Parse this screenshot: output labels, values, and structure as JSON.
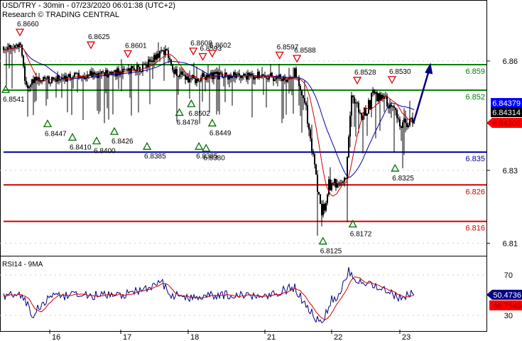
{
  "header": {
    "title": "USD/TRY - 30min - 07/23/2020 06:01:38 (UTC+2)",
    "subtitle": "Research © TRADING CENTRAL"
  },
  "chart_data": {
    "type": "candlestick",
    "symbol": "USD/TRY",
    "interval": "30min",
    "x_ticks": [
      "16",
      "17",
      "18",
      "21",
      "22",
      "23"
    ],
    "x_tick_days": [
      16,
      17,
      18,
      21,
      22,
      23
    ],
    "y_ticks": [
      6.86,
      6.83,
      6.81
    ],
    "price_path": [
      [
        15.33,
        6.864
      ],
      [
        15.6,
        6.864
      ],
      [
        15.66,
        6.853
      ],
      [
        15.75,
        6.8545
      ],
      [
        16.0,
        6.855
      ],
      [
        16.5,
        6.856
      ],
      [
        17.0,
        6.857
      ],
      [
        17.3,
        6.858
      ],
      [
        17.66,
        6.863
      ],
      [
        17.8,
        6.857
      ],
      [
        18.0,
        6.855
      ],
      [
        18.3,
        6.855
      ],
      [
        18.7,
        6.856
      ],
      [
        21.0,
        6.856
      ],
      [
        21.3,
        6.855
      ],
      [
        21.45,
        6.857
      ],
      [
        21.6,
        6.848
      ],
      [
        21.75,
        6.83
      ],
      [
        21.85,
        6.817
      ],
      [
        21.95,
        6.826
      ],
      [
        22.2,
        6.826
      ],
      [
        22.3,
        6.851
      ],
      [
        22.45,
        6.844
      ],
      [
        22.6,
        6.85
      ],
      [
        22.9,
        6.848
      ],
      [
        23.0,
        6.842
      ],
      [
        23.2,
        6.843
      ]
    ],
    "levels": [
      {
        "value": "6.859",
        "color": "#008000"
      },
      {
        "value": "6.852",
        "color": "#008000"
      },
      {
        "value": "6.835",
        "color": "#0000a0"
      },
      {
        "value": "6.826",
        "color": "#d00000"
      },
      {
        "value": "6.816",
        "color": "#d00000"
      }
    ],
    "highs": [
      {
        "day": 15.58,
        "value": "6.8660"
      },
      {
        "day": 16.58,
        "value": "6.8625"
      },
      {
        "day": 17.105,
        "value": "6.8601"
      },
      {
        "day": 18.2,
        "value": "6.8608"
      },
      {
        "day": 18.57,
        "value": "6.8593"
      },
      {
        "day": 18.94,
        "value": "6.8602"
      },
      {
        "day": 21.22,
        "value": "6.8597"
      },
      {
        "day": 21.48,
        "value": "6.8588"
      },
      {
        "day": 22.375,
        "value": "6.8528"
      },
      {
        "day": 22.885,
        "value": "6.8530"
      }
    ],
    "lows": [
      {
        "day": 15.38,
        "value": "6.8541"
      },
      {
        "day": 15.97,
        "value": "6.8447"
      },
      {
        "day": 16.32,
        "value": "6.8410"
      },
      {
        "day": 16.66,
        "value": "6.8400"
      },
      {
        "day": 16.91,
        "value": "6.8426"
      },
      {
        "day": 17.39,
        "value": "6.8385"
      },
      {
        "day": 17.87,
        "value": "6.8478"
      },
      {
        "day": 18.12,
        "value": "6.8502"
      },
      {
        "day": 18.42,
        "value": "6.8385"
      },
      {
        "day": 18.7,
        "value": "6.8380"
      },
      {
        "day": 18.94,
        "value": "6.8449"
      },
      {
        "day": 21.87,
        "value": "6.8125"
      },
      {
        "day": 22.31,
        "value": "6.8172"
      },
      {
        "day": 22.93,
        "value": "6.8325"
      }
    ],
    "projection": {
      "from": [
        23.2,
        6.843
      ],
      "to": [
        23.45,
        6.8595
      ],
      "color": "#000080"
    },
    "price_tags": [
      {
        "value": "6.84379",
        "bg": "#0000ff",
        "fg": "#ffffff"
      },
      {
        "value": "6.84314",
        "bg": "#000000",
        "fg": "#ffffff"
      },
      {
        "value": "6.84306",
        "bg": "#ff0000",
        "fg": "#cc0000"
      }
    ],
    "moving_averages": [
      {
        "color": "#d00000"
      },
      {
        "color": "#0000a0"
      }
    ],
    "rsi": {
      "title": "RSI14 - 9MA",
      "y_ticks": [
        70,
        30
      ],
      "path": [
        [
          15.33,
          48
        ],
        [
          15.55,
          53
        ],
        [
          15.7,
          40
        ],
        [
          15.75,
          28
        ],
        [
          15.85,
          38
        ],
        [
          16.0,
          48
        ],
        [
          16.5,
          50
        ],
        [
          17.0,
          50
        ],
        [
          17.5,
          58
        ],
        [
          17.6,
          66
        ],
        [
          17.7,
          52
        ],
        [
          18.0,
          47
        ],
        [
          18.5,
          50
        ],
        [
          21.0,
          50
        ],
        [
          21.45,
          58
        ],
        [
          21.6,
          40
        ],
        [
          21.8,
          25
        ],
        [
          21.85,
          20
        ],
        [
          22.0,
          47
        ],
        [
          22.1,
          48
        ],
        [
          22.25,
          75
        ],
        [
          22.35,
          65
        ],
        [
          22.5,
          63
        ],
        [
          22.8,
          55
        ],
        [
          23.0,
          47
        ],
        [
          23.15,
          50.5
        ]
      ],
      "rsi_value": "50.4736",
      "ma_value": "46.7545",
      "rsi_color": "#000080",
      "ma_color": "#d00000"
    }
  }
}
